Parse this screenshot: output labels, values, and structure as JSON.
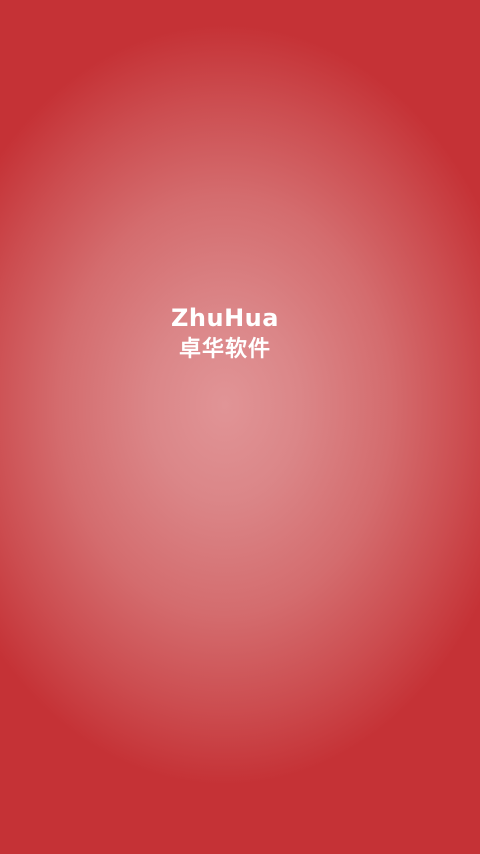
{
  "splash": {
    "brand_name_en": "ZhuHua",
    "brand_name_cn": "卓华软件"
  },
  "colors": {
    "background_center": "#e19496",
    "background_edge": "#c53236",
    "text": "#ffffff"
  }
}
